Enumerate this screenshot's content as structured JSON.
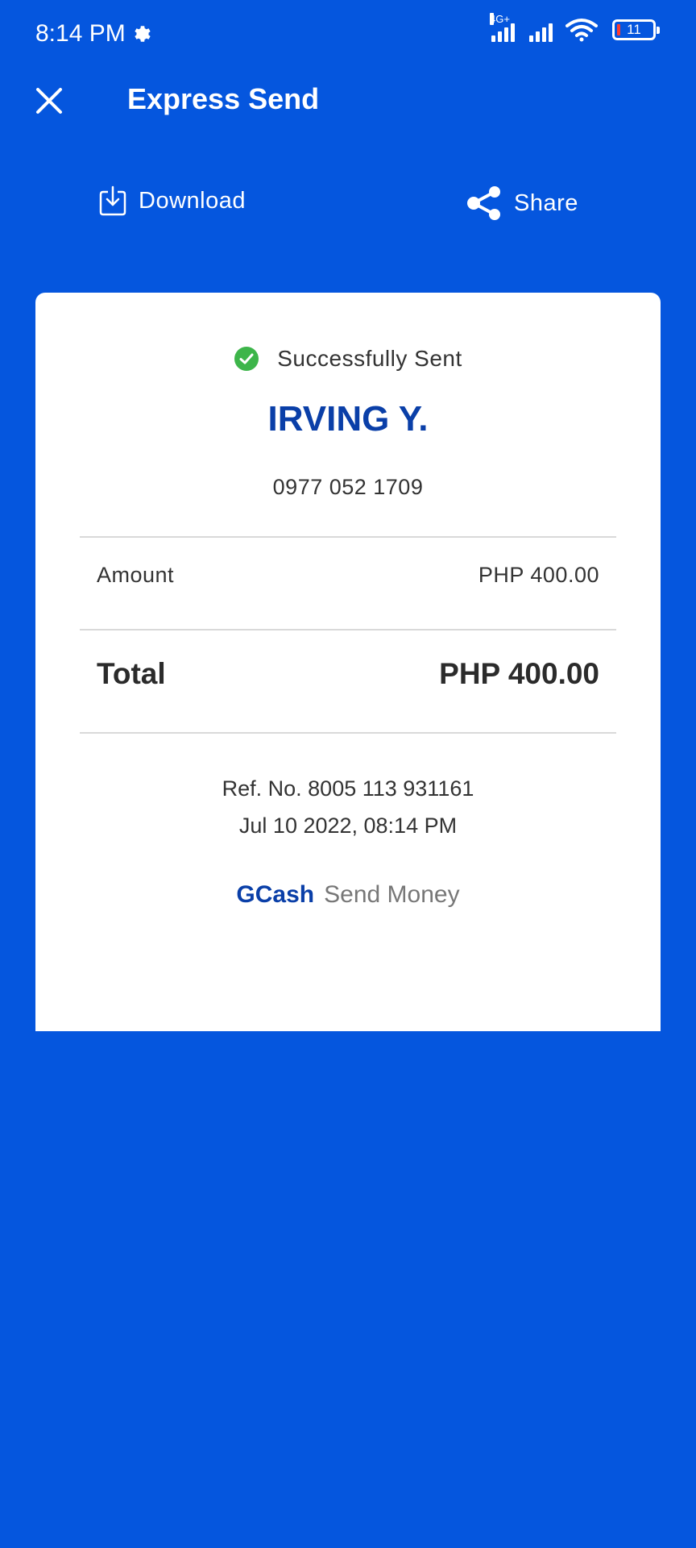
{
  "status_bar": {
    "time": "8:14 PM",
    "network_label": "4G+",
    "battery_level": "11"
  },
  "header": {
    "title": "Express Send",
    "close_icon": "close-icon"
  },
  "actions": {
    "download_label": "Download",
    "share_label": "Share"
  },
  "receipt": {
    "status_text": "Successfully Sent",
    "recipient_name": "IRVING Y.",
    "recipient_phone": "0977 052 1709",
    "amount_label": "Amount",
    "amount_value": "PHP 400.00",
    "total_label": "Total",
    "total_value": "PHP 400.00",
    "ref_no": "Ref. No. 8005 113 931161",
    "datetime": "Jul 10 2022, 08:14 PM",
    "brand": "GCash",
    "brand_sub": "Send Money"
  },
  "colors": {
    "background": "#0556DE",
    "brand_blue": "#0A3FA8",
    "success_green": "#3DB54A"
  }
}
